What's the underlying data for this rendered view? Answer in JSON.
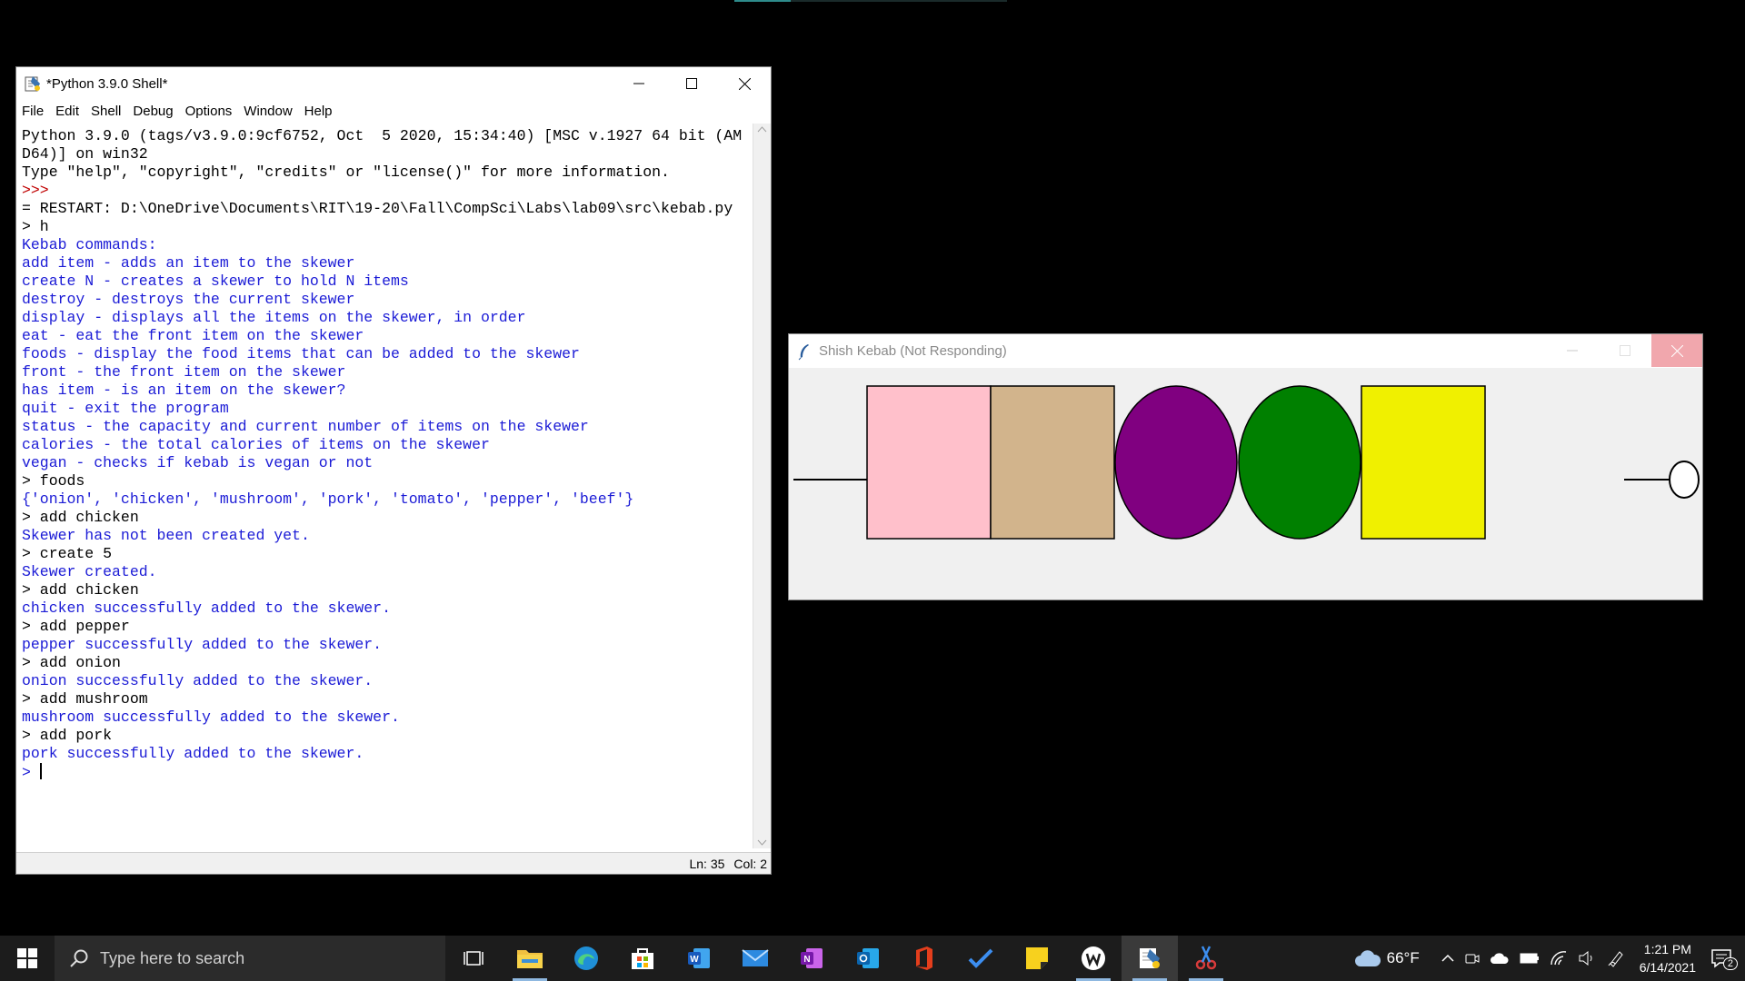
{
  "idle": {
    "title": "*Python 3.9.0 Shell*",
    "menu": [
      "File",
      "Edit",
      "Shell",
      "Debug",
      "Options",
      "Window",
      "Help"
    ],
    "banner": [
      "Python 3.9.0 (tags/v3.9.0:9cf6752, Oct  5 2020, 15:34:40) [MSC v.1927 64 bit (AM",
      "D64)] on win32",
      "Type \"help\", \"copyright\", \"credits\" or \"license()\" for more information."
    ],
    "prompt": ">>> ",
    "restart": "= RESTART: D:\\OneDrive\\Documents\\RIT\\19-20\\Fall\\CompSci\\Labs\\lab09\\src\\kebab.py",
    "session": [
      {
        "type": "input",
        "text": "> h"
      },
      {
        "type": "output",
        "text": "Kebab commands:"
      },
      {
        "type": "output",
        "text": "add item - adds an item to the skewer"
      },
      {
        "type": "output",
        "text": "create N - creates a skewer to hold N items"
      },
      {
        "type": "output",
        "text": "destroy - destroys the current skewer"
      },
      {
        "type": "output",
        "text": "display - displays all the items on the skewer, in order"
      },
      {
        "type": "output",
        "text": "eat - eat the front item on the skewer"
      },
      {
        "type": "output",
        "text": "foods - display the food items that can be added to the skewer"
      },
      {
        "type": "output",
        "text": "front - the front item on the skewer"
      },
      {
        "type": "output",
        "text": "has item - is an item on the skewer?"
      },
      {
        "type": "output",
        "text": "quit - exit the program"
      },
      {
        "type": "output",
        "text": "status - the capacity and current number of items on the skewer"
      },
      {
        "type": "output",
        "text": "calories - the total calories of items on the skewer"
      },
      {
        "type": "output",
        "text": "vegan - checks if kebab is vegan or not"
      },
      {
        "type": "input",
        "text": "> foods"
      },
      {
        "type": "output",
        "text": "{'onion', 'chicken', 'mushroom', 'pork', 'tomato', 'pepper', 'beef'}"
      },
      {
        "type": "input",
        "text": "> add chicken"
      },
      {
        "type": "output",
        "text": "Skewer has not been created yet."
      },
      {
        "type": "input",
        "text": "> create 5"
      },
      {
        "type": "output",
        "text": "Skewer created."
      },
      {
        "type": "input",
        "text": "> add chicken"
      },
      {
        "type": "output",
        "text": "chicken successfully added to the skewer."
      },
      {
        "type": "input",
        "text": "> add pepper"
      },
      {
        "type": "output",
        "text": "pepper successfully added to the skewer."
      },
      {
        "type": "input",
        "text": "> add onion"
      },
      {
        "type": "output",
        "text": "onion successfully added to the skewer."
      },
      {
        "type": "input",
        "text": "> add mushroom"
      },
      {
        "type": "output",
        "text": "mushroom successfully added to the skewer."
      },
      {
        "type": "input",
        "text": "> add pork"
      },
      {
        "type": "output",
        "text": "pork successfully added to the skewer."
      }
    ],
    "current_prompt": "> ",
    "status": {
      "ln": "Ln: 35",
      "col": "Col: 2"
    }
  },
  "kebab": {
    "title": "Shish Kebab (Not Responding)",
    "items": [
      {
        "shape": "rect",
        "color": "#ffc0cb"
      },
      {
        "shape": "rect",
        "color": "#d2b48c"
      },
      {
        "shape": "oval",
        "color": "#800080"
      },
      {
        "shape": "oval",
        "color": "#008000"
      },
      {
        "shape": "rect",
        "color": "#f0f000"
      }
    ]
  },
  "taskbar": {
    "search_placeholder": "Type here to search",
    "apps": [
      "task-view",
      "file-explorer",
      "edge",
      "store",
      "word",
      "mail",
      "onenote",
      "outlook",
      "office",
      "todo",
      "sticky-notes",
      "wattpad",
      "python-idle",
      "snipping-tool"
    ],
    "weather": "66°F",
    "time": "1:21 PM",
    "date": "6/14/2021",
    "notifications": "2"
  }
}
